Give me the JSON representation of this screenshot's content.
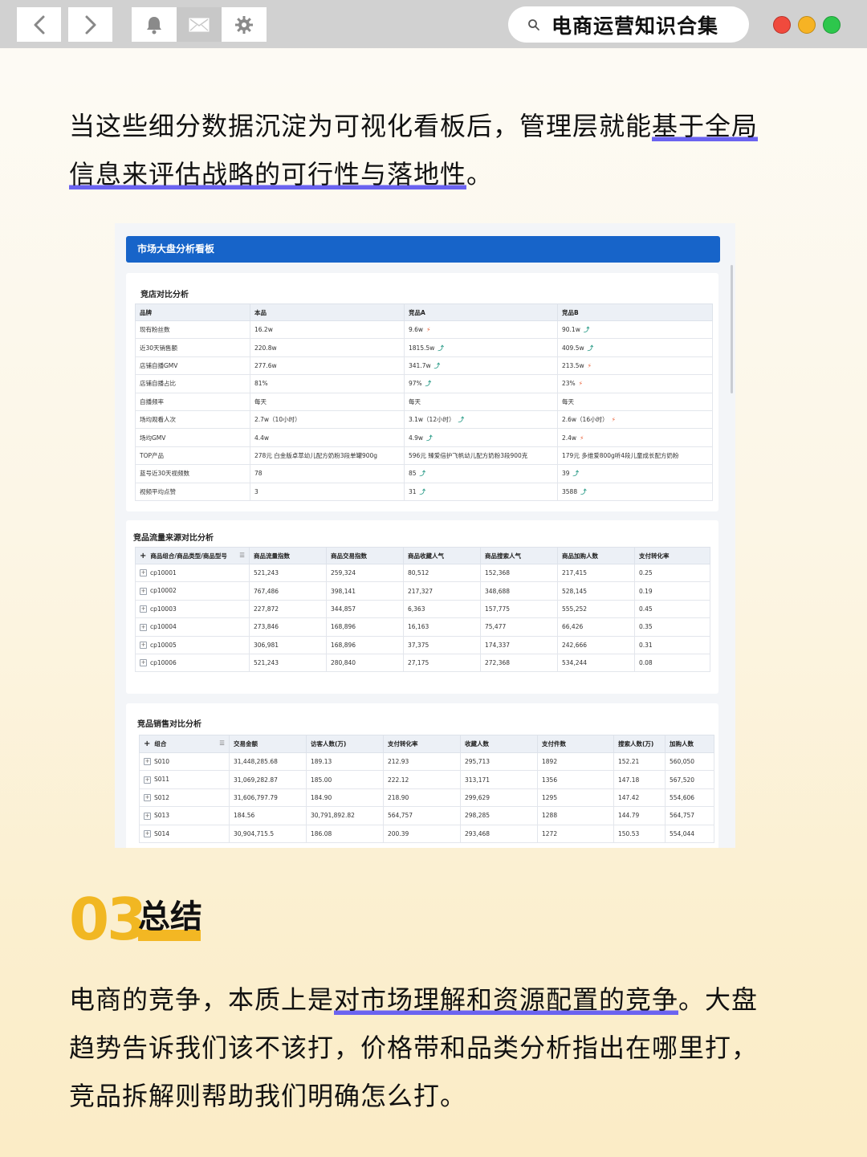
{
  "browser": {
    "title": "电商运营知识合集",
    "traffic_colors": [
      "#f04a3d",
      "#f6b324",
      "#2dc74c"
    ]
  },
  "intro": {
    "text_plain": "当这些细分数据沉淀为可视化看板后，管理层就能",
    "text_highlight": "基于全局信息来评估战略的可行性与落地性",
    "text_end": "。"
  },
  "dashboard": {
    "title": "市场大盘分析看板",
    "shop_compare": {
      "title": "竞店对比分析",
      "headers": [
        "品牌",
        "本品",
        "竞品A",
        "竞品B"
      ],
      "rows": [
        {
          "label": "现有粉丝数",
          "own": "16.2w",
          "a": "9.6w",
          "a_trend": "down",
          "b": "90.1w",
          "b_trend": "up"
        },
        {
          "label": "近30天销售额",
          "own": "220.8w",
          "a": "1815.5w",
          "a_trend": "up",
          "b": "409.5w",
          "b_trend": "up"
        },
        {
          "label": "店铺自播GMV",
          "own": "277.6w",
          "a": "341.7w",
          "a_trend": "up",
          "b": "213.5w",
          "b_trend": "down"
        },
        {
          "label": "店铺自播占比",
          "own": "81%",
          "a": "97%",
          "a_trend": "up",
          "b": "23%",
          "b_trend": "down"
        },
        {
          "label": "自播频率",
          "own": "每天",
          "a": "每天",
          "a_trend": "",
          "b": "每天",
          "b_trend": ""
        },
        {
          "label": "场均观看人次",
          "own": "2.7w（10小时）",
          "a": "3.1w（12小时）",
          "a_trend": "up",
          "b": "2.6w（16小时）",
          "b_trend": "down"
        },
        {
          "label": "场均GMV",
          "own": "4.4w",
          "a": "4.9w",
          "a_trend": "up",
          "b": "2.4w",
          "b_trend": "down"
        },
        {
          "label": "TOP产品",
          "own": "278元 白金版卓萃幼儿配方奶粉3段单罐900g",
          "a": "596元 臻爱倍护飞帆幼儿配方奶粉3段900克",
          "a_trend": "",
          "b": "179元 多维爱800g听4段儿童成长配方奶粉",
          "b_trend": ""
        },
        {
          "label": "蓝号近30天视频数",
          "own": "78",
          "a": "85",
          "a_trend": "up",
          "b": "39",
          "b_trend": "up"
        },
        {
          "label": "视频平均点赞",
          "own": "3",
          "a": "31",
          "a_trend": "up",
          "b": "3588",
          "b_trend": "up"
        }
      ]
    },
    "traffic": {
      "title": "竞品流量来源对比分析",
      "headers": [
        "商品组合/商品类型/商品型号",
        "商品流量指数",
        "商品交易指数",
        "商品收藏人气",
        "商品搜索人气",
        "商品加购人数",
        "支付转化率"
      ],
      "rows": [
        [
          "cp10001",
          "521,243",
          "259,324",
          "80,512",
          "152,368",
          "217,415",
          "0.25"
        ],
        [
          "cp10002",
          "767,486",
          "398,141",
          "217,327",
          "348,688",
          "528,145",
          "0.19"
        ],
        [
          "cp10003",
          "227,872",
          "344,857",
          "6,363",
          "157,775",
          "555,252",
          "0.45"
        ],
        [
          "cp10004",
          "273,846",
          "168,896",
          "16,163",
          "75,477",
          "66,426",
          "0.35"
        ],
        [
          "cp10005",
          "306,981",
          "168,896",
          "37,375",
          "174,337",
          "242,666",
          "0.31"
        ],
        [
          "cp10006",
          "521,243",
          "280,840",
          "27,175",
          "272,368",
          "534,244",
          "0.08"
        ]
      ]
    },
    "sales": {
      "title": "竞品销售对比分析",
      "headers": [
        "组合",
        "交易金额",
        "访客人数(万)",
        "支付转化率",
        "收藏人数",
        "支付件数",
        "搜索人数(万)",
        "加购人数"
      ],
      "rows": [
        [
          "S010",
          "31,448,285.68",
          "189.13",
          "212.93",
          "295,713",
          "1892",
          "152.21",
          "560,050"
        ],
        [
          "S011",
          "31,069,282.87",
          "185.00",
          "222.12",
          "313,171",
          "1356",
          "147.18",
          "567,520"
        ],
        [
          "S012",
          "31,606,797.79",
          "184.90",
          "218.90",
          "299,629",
          "1295",
          "147.42",
          "554,606"
        ],
        [
          "S013",
          "184.56",
          "30,791,892.82",
          "564,757",
          "298,285",
          "1288",
          "144.79",
          "564,757"
        ],
        [
          "S014",
          "30,904,715.5",
          "186.08",
          "200.39",
          "293,468",
          "1272",
          "150.53",
          "554,044"
        ]
      ]
    }
  },
  "section": {
    "number": "03",
    "title": "总结"
  },
  "summary": {
    "text_plain": "电商的竞争，本质上是",
    "text_highlight": "对市场理解和资源配置的竞争",
    "text_end": "。大盘趋势告诉我们该不该打，价格带和品类分析指出在哪里打，竞品拆解则帮助我们明确怎么打。"
  }
}
